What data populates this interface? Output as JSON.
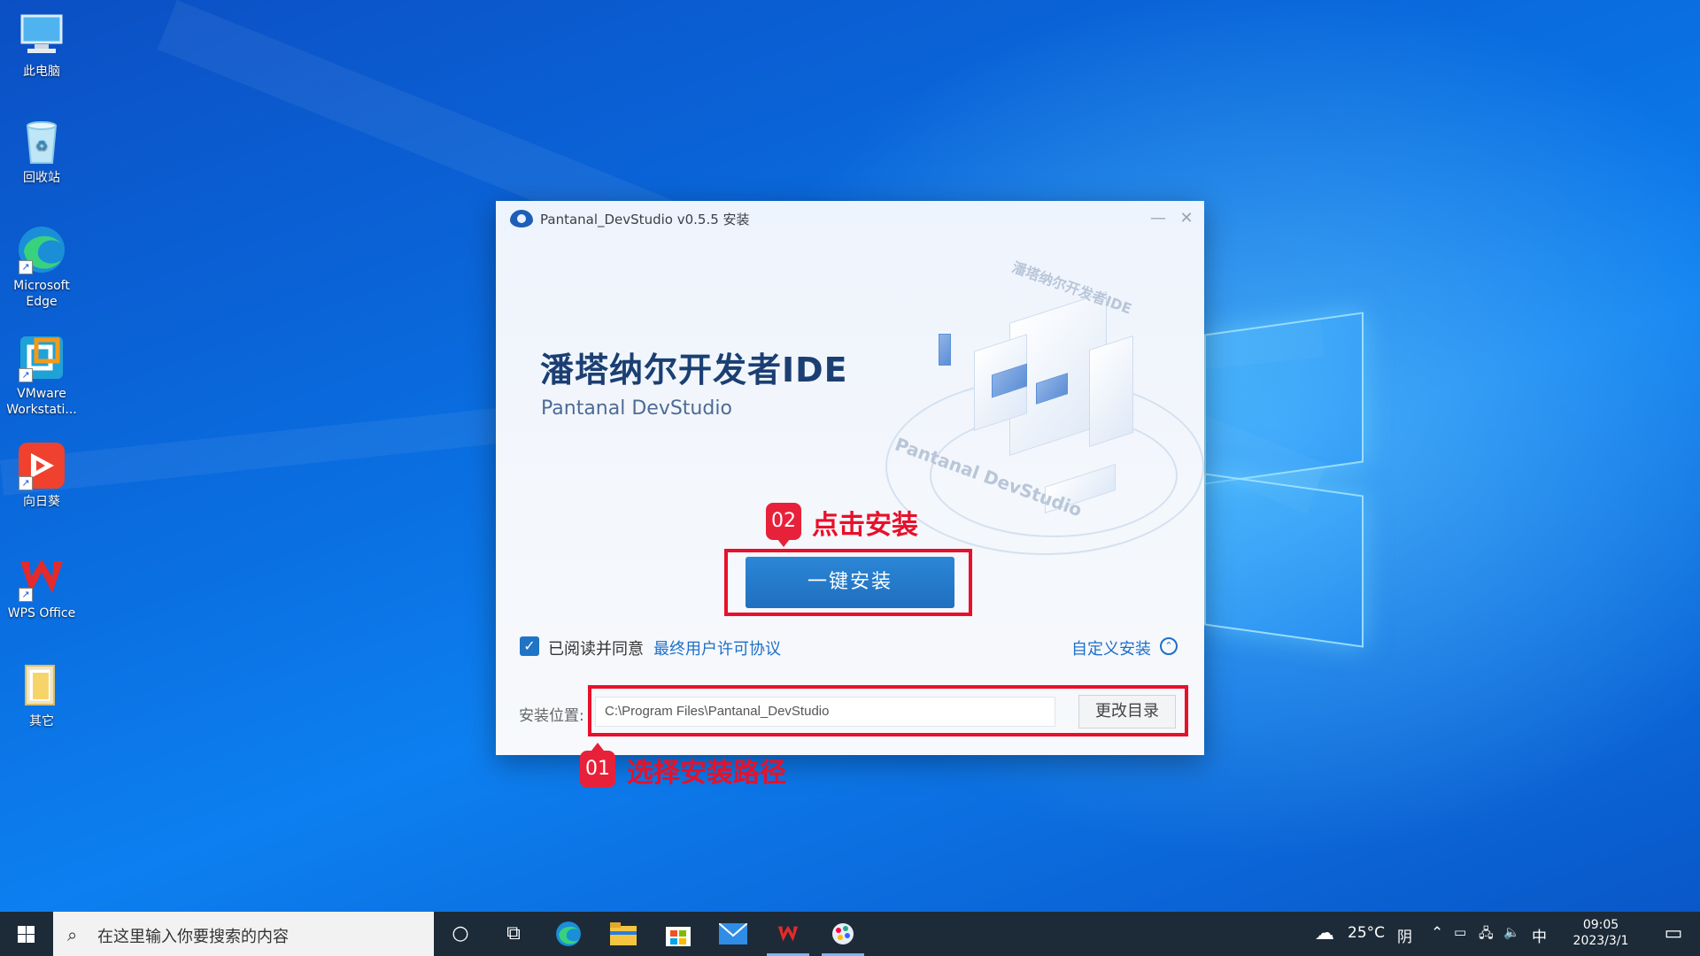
{
  "desktop": {
    "icons": [
      {
        "label": "此电脑",
        "icon": "computer-icon"
      },
      {
        "label": "回收站",
        "icon": "recycle-bin-icon"
      },
      {
        "label": "Microsoft Edge",
        "icon": "edge-icon"
      },
      {
        "label": "VMware Workstati...",
        "icon": "vmware-icon"
      },
      {
        "label": "向日葵",
        "icon": "sunlogin-icon"
      },
      {
        "label": "WPS Office",
        "icon": "wps-icon"
      },
      {
        "label": "其它",
        "icon": "folder-icon"
      }
    ]
  },
  "installer": {
    "title": "Pantanal_DevStudio v0.5.5 安装",
    "minimize": "—",
    "close": "✕",
    "hero_title": "潘塔纳尔开发者IDE",
    "hero_subtitle": "Pantanal DevStudio",
    "art_label_top": "潘塔纳尔开发者IDE",
    "art_label_bottom": "Pantanal DevStudio",
    "install_button": "一键安装",
    "agree_checked": true,
    "agree_text": "已阅读并同意",
    "eula_link": "最终用户许可协议",
    "custom_install": "自定义安装",
    "path_label": "安装位置:",
    "path_value": "C:\\Program Files\\Pantanal_DevStudio",
    "change_dir_button": "更改目录"
  },
  "annotations": {
    "step2_number": "02",
    "step2_text": "点击安装",
    "step1_number": "01",
    "step1_text": "选择安装路径",
    "color": "#e8102a"
  },
  "taskbar": {
    "search_placeholder": "在这里输入你要搜索的内容",
    "weather_temp": "25°C",
    "weather_cond": "阴",
    "ime": "中",
    "time": "09:05",
    "date": "2023/3/1"
  }
}
